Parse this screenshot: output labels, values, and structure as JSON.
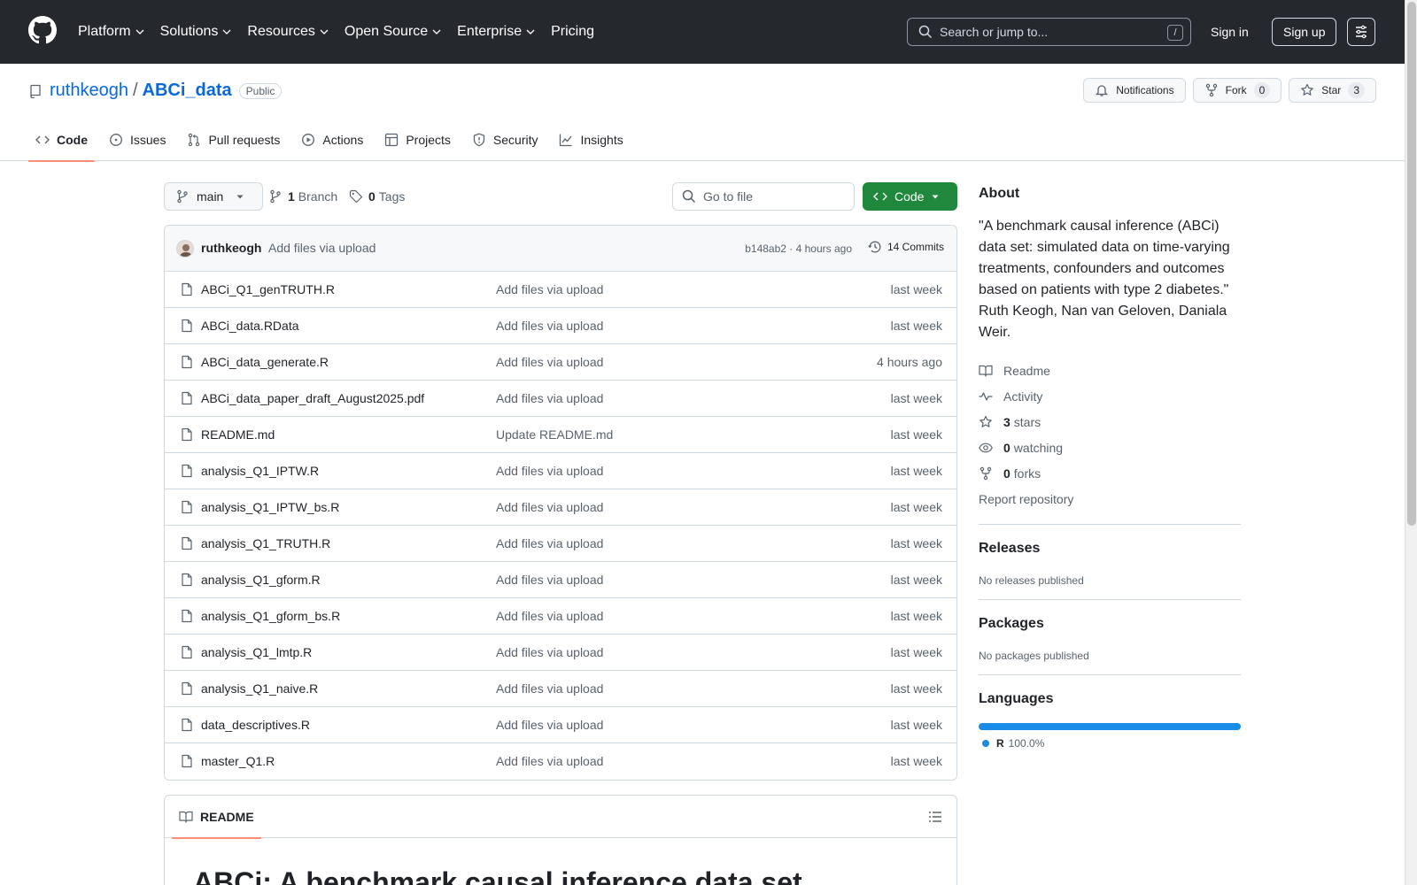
{
  "header": {
    "nav": [
      {
        "label": "Platform",
        "has_menu": true
      },
      {
        "label": "Solutions",
        "has_menu": true
      },
      {
        "label": "Resources",
        "has_menu": true
      },
      {
        "label": "Open Source",
        "has_menu": true
      },
      {
        "label": "Enterprise",
        "has_menu": true
      },
      {
        "label": "Pricing",
        "has_menu": false
      }
    ],
    "search_placeholder": "Search or jump to...",
    "search_shortcut": "/",
    "signin": "Sign in",
    "signup": "Sign up"
  },
  "repo": {
    "owner": "ruthkeogh",
    "separator": "/",
    "name": "ABCi_data",
    "visibility": "Public",
    "notifications_label": "Notifications",
    "fork_label": "Fork",
    "fork_count": "0",
    "star_label": "Star",
    "star_count": "3",
    "tabs": [
      {
        "label": "Code",
        "icon": "code-icon",
        "active": true
      },
      {
        "label": "Issues",
        "icon": "issue-icon",
        "active": false
      },
      {
        "label": "Pull requests",
        "icon": "pull-request-icon",
        "active": false
      },
      {
        "label": "Actions",
        "icon": "play-icon",
        "active": false
      },
      {
        "label": "Projects",
        "icon": "table-icon",
        "active": false
      },
      {
        "label": "Security",
        "icon": "shield-icon",
        "active": false
      },
      {
        "label": "Insights",
        "icon": "graph-icon",
        "active": false
      }
    ]
  },
  "toolbar": {
    "branch": "main",
    "branch_count": "1",
    "branch_label": "Branch",
    "tag_count": "0",
    "tag_label": "Tags",
    "goto_placeholder": "Go to file",
    "code_label": "Code"
  },
  "latest_commit": {
    "author": "ruthkeogh",
    "message": "Add files via upload",
    "meta": "b148ab2 · 4 hours ago",
    "commits": "14 Commits"
  },
  "files": [
    {
      "name": "ABCi_Q1_genTRUTH.R",
      "message": "Add files via upload",
      "date": "last week"
    },
    {
      "name": "ABCi_data.RData",
      "message": "Add files via upload",
      "date": "last week"
    },
    {
      "name": "ABCi_data_generate.R",
      "message": "Add files via upload",
      "date": "4 hours ago"
    },
    {
      "name": "ABCi_data_paper_draft_August2025.pdf",
      "message": "Add files via upload",
      "date": "last week"
    },
    {
      "name": "README.md",
      "message": "Update README.md",
      "date": "last week"
    },
    {
      "name": "analysis_Q1_IPTW.R",
      "message": "Add files via upload",
      "date": "last week"
    },
    {
      "name": "analysis_Q1_IPTW_bs.R",
      "message": "Add files via upload",
      "date": "last week"
    },
    {
      "name": "analysis_Q1_TRUTH.R",
      "message": "Add files via upload",
      "date": "last week"
    },
    {
      "name": "analysis_Q1_gform.R",
      "message": "Add files via upload",
      "date": "last week"
    },
    {
      "name": "analysis_Q1_gform_bs.R",
      "message": "Add files via upload",
      "date": "last week"
    },
    {
      "name": "analysis_Q1_lmtp.R",
      "message": "Add files via upload",
      "date": "last week"
    },
    {
      "name": "analysis_Q1_naive.R",
      "message": "Add files via upload",
      "date": "last week"
    },
    {
      "name": "data_descriptives.R",
      "message": "Add files via upload",
      "date": "last week"
    },
    {
      "name": "master_Q1.R",
      "message": "Add files via upload",
      "date": "last week"
    }
  ],
  "readme": {
    "tab_label": "README",
    "heading": "ABCi: A benchmark causal inference data set"
  },
  "about": {
    "title": "About",
    "description": "\"A benchmark causal inference (ABCi) data set: simulated data on time-varying treatments, confounders and outcomes based on patients with type 2 diabetes.\" Ruth Keogh, Nan van Geloven, Daniala Weir.",
    "readme_link": "Readme",
    "activity_link": "Activity",
    "stars_count": "3",
    "stars_label": "stars",
    "watching_count": "0",
    "watching_label": "watching",
    "forks_count": "0",
    "forks_label": "forks",
    "report": "Report repository"
  },
  "releases": {
    "title": "Releases",
    "note": "No releases published"
  },
  "packages": {
    "title": "Packages",
    "note": "No packages published"
  },
  "languages": {
    "title": "Languages",
    "items": [
      {
        "name": "R",
        "percent": "100.0%",
        "fraction": 1.0,
        "color": "#198ce7"
      }
    ]
  },
  "colors": {
    "header_bg": "#25292e",
    "link": "#0969da",
    "code_button": "#1f883d",
    "active_tab_underline": "#fd8c73"
  }
}
